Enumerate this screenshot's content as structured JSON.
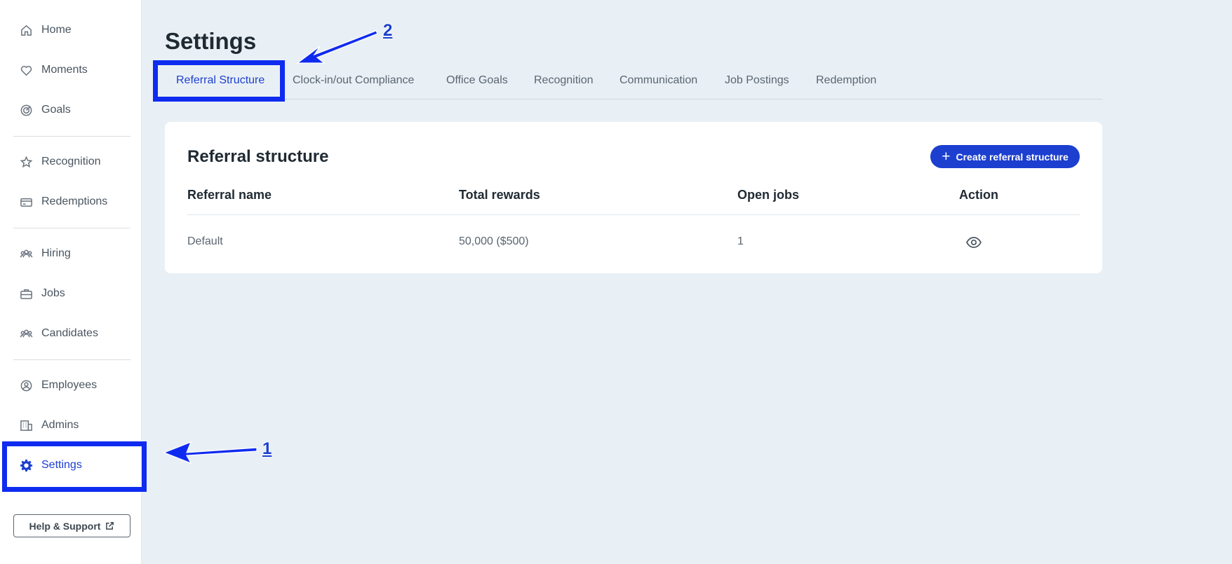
{
  "sidebar": {
    "items": [
      {
        "label": "Home",
        "icon": "home-icon"
      },
      {
        "label": "Moments",
        "icon": "heart-icon"
      },
      {
        "label": "Goals",
        "icon": "target-icon"
      },
      {
        "label": "Recognition",
        "icon": "star-icon"
      },
      {
        "label": "Redemptions",
        "icon": "card-icon"
      },
      {
        "label": "Hiring",
        "icon": "people-icon"
      },
      {
        "label": "Jobs",
        "icon": "briefcase-icon"
      },
      {
        "label": "Candidates",
        "icon": "people-icon"
      },
      {
        "label": "Employees",
        "icon": "user-circle-icon"
      },
      {
        "label": "Admins",
        "icon": "building-icon"
      },
      {
        "label": "Settings",
        "icon": "gear-icon",
        "active": true
      }
    ],
    "help_label": "Help & Support"
  },
  "page": {
    "title": "Settings",
    "tabs": [
      {
        "label": "Referral Structure",
        "active": true
      },
      {
        "label": "Clock-in/out Compliance"
      },
      {
        "label": "Office Goals"
      },
      {
        "label": "Recognition"
      },
      {
        "label": "Communication"
      },
      {
        "label": "Job Postings"
      },
      {
        "label": "Redemption"
      }
    ]
  },
  "card": {
    "title": "Referral structure",
    "create_button": "Create referral structure",
    "columns": [
      "Referral name",
      "Total rewards",
      "Open jobs",
      "Action"
    ],
    "rows": [
      {
        "name": "Default",
        "rewards": "50,000 ($500)",
        "open_jobs": "1",
        "action_icon": "eye-icon"
      }
    ]
  },
  "annotations": {
    "one": "1",
    "two": "2"
  },
  "colors": {
    "accent": "#1c3fcf",
    "annotation": "#0f2bf0",
    "background": "#e9f0f5"
  }
}
